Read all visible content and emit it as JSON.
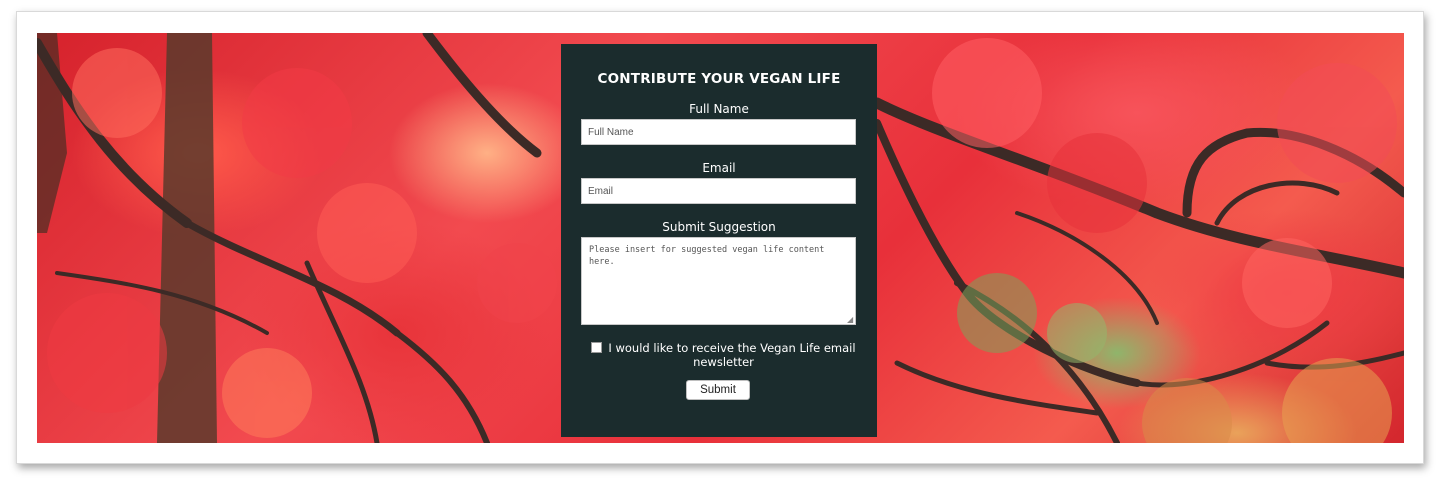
{
  "form": {
    "title": "CONTRIBUTE YOUR VEGAN LIFE",
    "full_name": {
      "label": "Full Name",
      "placeholder": "Full Name",
      "value": ""
    },
    "email": {
      "label": "Email",
      "placeholder": "Email",
      "value": ""
    },
    "suggestion": {
      "label": "Submit Suggestion",
      "placeholder": "Please insert for suggested vegan life content here.",
      "value": ""
    },
    "newsletter": {
      "label": "I would like to receive the Vegan Life email newsletter",
      "checked": false
    },
    "submit_label": "Submit"
  },
  "background": {
    "image": "red-maple-tree-photo",
    "card_color": "#1b2c2d"
  }
}
